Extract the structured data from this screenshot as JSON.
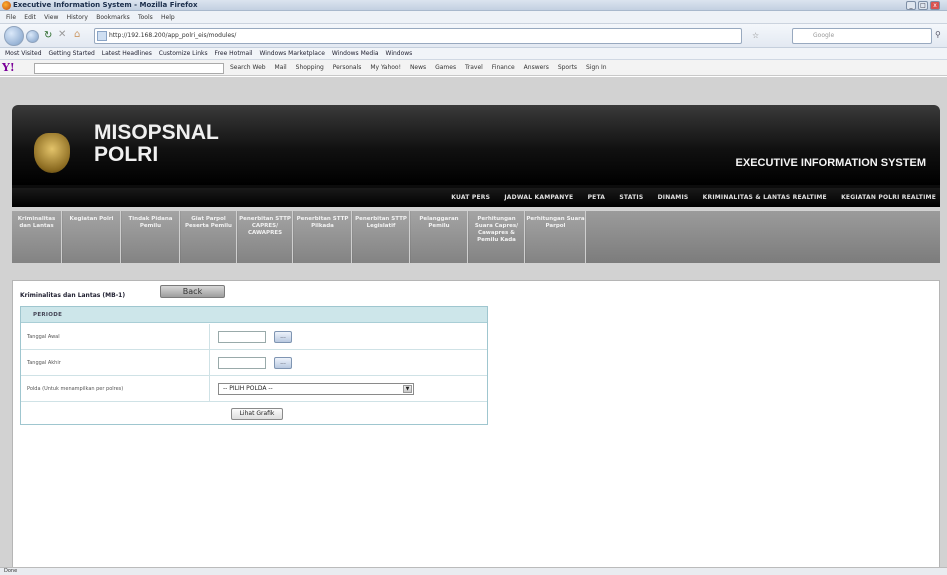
{
  "window": {
    "title": "Executive Information System - Mozilla Firefox",
    "controls": [
      "_",
      "□",
      "x"
    ]
  },
  "menu": [
    "File",
    "Edit",
    "View",
    "History",
    "Bookmarks",
    "Tools",
    "Help"
  ],
  "nav": {
    "url": "http://192.168.200/app_polri_eis/modules/",
    "search_placeholder": "Google"
  },
  "bookmarks": [
    "Most Visited",
    "Getting Started",
    "Latest Headlines",
    "Customize Links",
    "Free Hotmail",
    "Windows Marketplace",
    "Windows Media",
    "Windows"
  ],
  "yahoo": {
    "logo": "Y!",
    "items": [
      "Search Web",
      "Mail",
      "Shopping",
      "Personals",
      "My Yahoo!",
      "News",
      "Games",
      "Travel",
      "Finance",
      "Answers",
      "Sports",
      "Sign In"
    ]
  },
  "site": {
    "brand_line1": "MISOPSNAL",
    "brand_line2": "POLRI",
    "subtitle": "EXECUTIVE INFORMATION SYSTEM",
    "top_nav": [
      "KUAT PERS",
      "JADWAL KAMPANYE",
      "PETA",
      "STATIS",
      "DINAMIS",
      "KRIMINALITAS & LANTAS REALTIME",
      "KEGIATAN POLRI REALTIME"
    ],
    "sub_menu": [
      "Kriminalitas dan Lantas",
      "Kegiatan Polri",
      "Tindak Pidana Pemilu",
      "Giat Parpol Peserta Pemilu",
      "Penerbitan STTP CAPRES/ CAWAPRES",
      "Penerbitan STTP Pilkada",
      "Penerbitan STTP Legislatif",
      "Pelanggaran Pemilu",
      "Perhitungan Suara Capres/ Cawapres & Pemilu Kada",
      "Perhitungan Suara Parpol"
    ]
  },
  "page": {
    "title": "Kriminalitas dan Lantas (MB-1)",
    "back_label": "Back",
    "form_header": "PERIODE",
    "label_awal": "Tanggal Awal",
    "label_akhir": "Tanggal Akhir",
    "label_polda": "Polda (Untuk menampilkan per polres)",
    "cal_btn": "...",
    "polda_selected": "-- PILIH POLDA --",
    "submit_label": "Lihat Grafik"
  },
  "status": "Done"
}
